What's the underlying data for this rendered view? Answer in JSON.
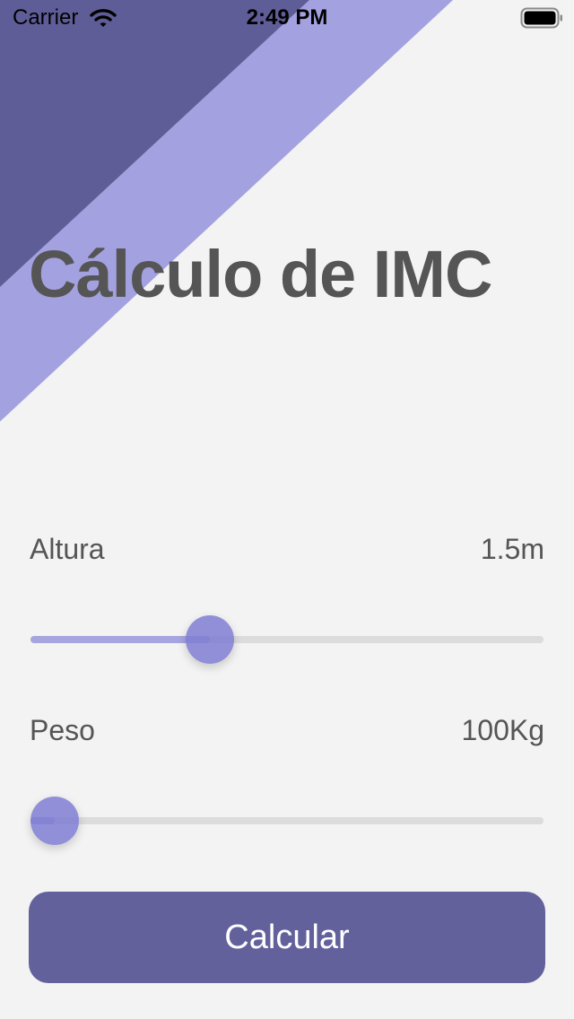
{
  "status_bar": {
    "carrier": "Carrier",
    "time": "2:49 PM",
    "wifi_icon": "wifi-icon",
    "battery_icon": "battery-full-icon"
  },
  "theme": {
    "background": "#f3f3f3",
    "dark_stripe": "#5f5d97",
    "light_stripe": "#a3a1df",
    "accent": "#8f8dd8",
    "button": "#63619b",
    "text": "#555555"
  },
  "title": "Cálculo de IMC",
  "height_row": {
    "label": "Altura",
    "value": "1.5m",
    "slider_level": 0.349
  },
  "weight_row": {
    "label": "Peso",
    "value": "100Kg",
    "slider_level": 0.047
  },
  "calculate_button": {
    "label": "Calcular"
  }
}
